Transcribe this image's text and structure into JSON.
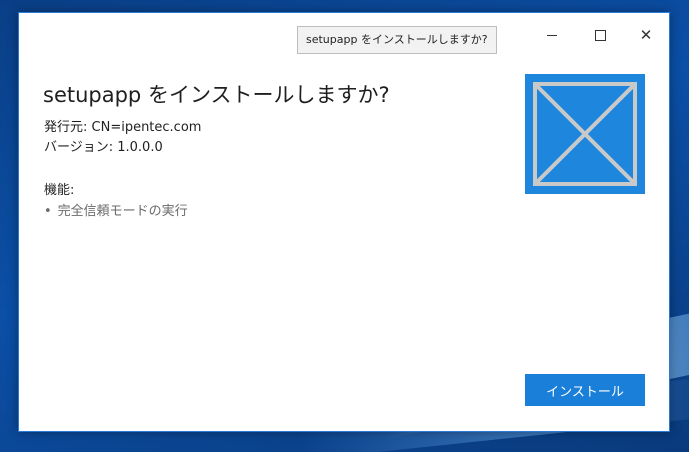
{
  "tooltip": {
    "text": "setupapp をインストールしますか?"
  },
  "window": {
    "controls": {
      "minimize": "—",
      "maximize": "☐",
      "close": "✕"
    }
  },
  "installer": {
    "title": "setupapp をインストールしますか?",
    "publisher": "発行元: CN=ipentec.com",
    "version": "バージョン: 1.0.0.0",
    "capabilities_label": "機能:",
    "capabilities": [
      {
        "bullet": "•",
        "label": "完全信頼モードの実行"
      }
    ],
    "install_button_label": "インストール",
    "logo_icon": "placeholder-x-icon"
  },
  "colors": {
    "accent": "#1a7fd9",
    "logo_bg": "#1e86dc",
    "desktop_bg": "#0b4fa6"
  }
}
